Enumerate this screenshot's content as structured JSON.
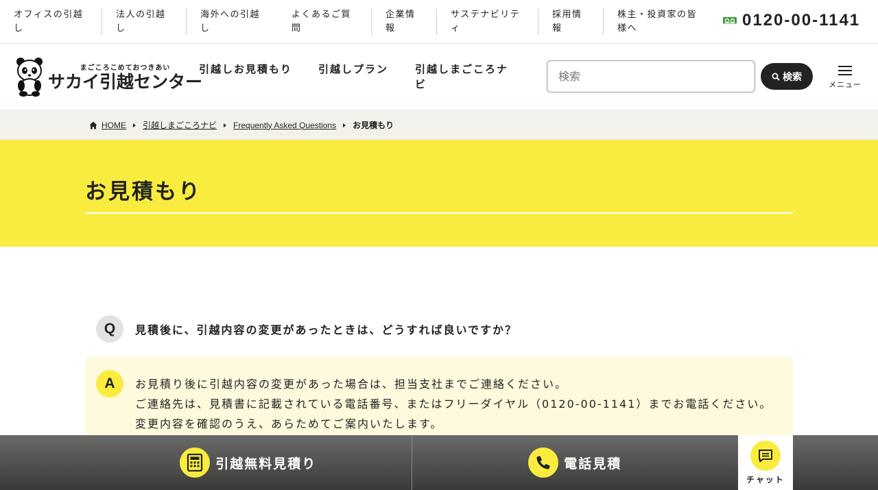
{
  "top_links": [
    {
      "label": "オフィスの引越し"
    },
    {
      "label": "法人の引越し"
    },
    {
      "label": "海外への引越し"
    },
    {
      "label": "よくあるご質問"
    },
    {
      "label": "企業情報"
    },
    {
      "label": "サステナビリティ"
    },
    {
      "label": "採用情報"
    },
    {
      "label": "株主・投資家の皆様へ"
    }
  ],
  "phone": {
    "number": "0120-00-1141",
    "icon": "free-dial-icon"
  },
  "logo": {
    "tagline": "まごころこめておつきあい",
    "name": "サカイ引越センター"
  },
  "nav": [
    {
      "label": "引越しお見積もり"
    },
    {
      "label": "引越しプラン"
    },
    {
      "label": "引越しまごころナビ"
    }
  ],
  "search": {
    "placeholder": "検索",
    "button_label": "検索"
  },
  "menu": {
    "label": "メニュー"
  },
  "breadcrumb": {
    "home": "HOME",
    "items": [
      "引越しまごころナビ",
      "Frequently Asked Questions"
    ],
    "current": "お見積もり"
  },
  "page": {
    "title": "お見積もり"
  },
  "faq": {
    "q_badge": "Q",
    "question": "見積後に、引越内容の変更があったときは、どうすれば良いですか？",
    "a_badge": "A",
    "answer_lines": [
      "お見積り後に引越内容の変更があった場合は、担当支社までご連絡ください。",
      "ご連絡先は、見積書に記載されている電話番号、またはフリーダイヤル（0120-00-1141）までお電話ください。",
      "変更内容を確認のうえ、あらためてご案内いたします。"
    ]
  },
  "bottom_bar": {
    "estimate_label": "引越無料見積り",
    "phone_label": "電話見積",
    "chat_label": "チャット"
  },
  "colors": {
    "accent": "#f9ec3f",
    "dark": "#222222",
    "answer_bg": "#fffade",
    "crumb_bg": "#f2f1ec"
  }
}
